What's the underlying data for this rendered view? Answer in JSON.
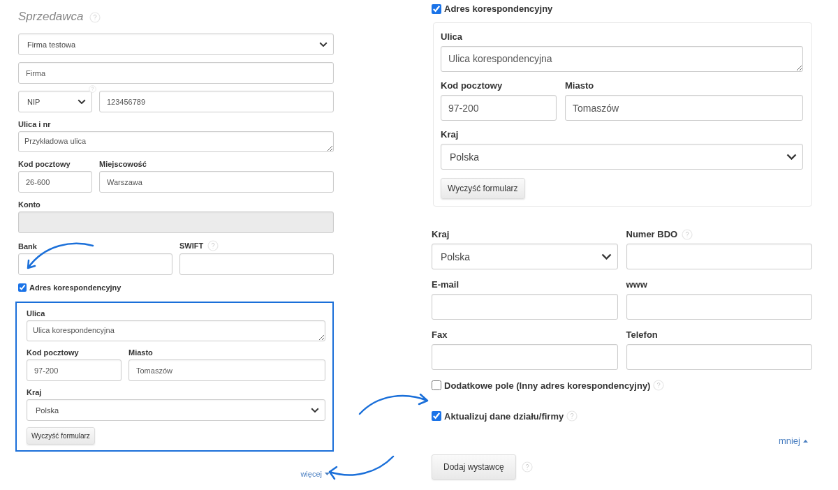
{
  "seller": {
    "title": "Sprzedawca",
    "title_help": true,
    "company": {
      "value": "Firma testowa"
    },
    "name": {
      "value": "Firma"
    },
    "tax_id": {
      "type": "NIP",
      "value": "123456789",
      "help": true
    },
    "street": {
      "label": "Ulica i nr",
      "value": "Przykładowa ulica"
    },
    "postal_code": {
      "label": "Kod pocztowy",
      "value": "26-600"
    },
    "city": {
      "label": "Miejscowość",
      "value": "Warszawa"
    },
    "account": {
      "label": "Konto",
      "disabled": true
    },
    "bank": {
      "label": "Bank"
    },
    "swift": {
      "label": "SWIFT",
      "help": true
    },
    "correspondence": {
      "label": "Adres korespondencyjny",
      "checked": true,
      "highlighted": true,
      "street": {
        "label": "Ulica",
        "value": "Ulica korespondencyjna"
      },
      "postal_code": {
        "label": "Kod pocztowy",
        "value": "97-200"
      },
      "city": {
        "label": "Miasto",
        "value": "Tomaszów"
      },
      "country": {
        "label": "Kraj",
        "value": "Polska"
      },
      "clear_button": "Wyczyść formularz"
    },
    "more_link": "więcej"
  },
  "expanded": {
    "correspondence": {
      "label": "Adres korespondencyjny",
      "checked": true,
      "highlighted": false,
      "street": {
        "label": "Ulica",
        "value": "Ulica korespondencyjna"
      },
      "postal_code": {
        "label": "Kod pocztowy",
        "value": "97-200"
      },
      "city": {
        "label": "Miasto",
        "value": "Tomaszów"
      },
      "country": {
        "label": "Kraj",
        "value": "Polska"
      },
      "clear_button": "Wyczyść formularz"
    },
    "country": {
      "label": "Kraj",
      "value": "Polska"
    },
    "bdo": {
      "label": "Numer BDO",
      "help": true
    },
    "email": {
      "label": "E-mail"
    },
    "www": {
      "label": "www"
    },
    "fax": {
      "label": "Fax"
    },
    "phone": {
      "label": "Telefon"
    },
    "extra_field": {
      "label": "Dodatkowe pole (Inny adres korespondencyjny)",
      "checked": false,
      "help": true
    },
    "update_company": {
      "label": "Aktualizuj dane działu/firmy",
      "checked": true,
      "help": true
    },
    "less_link": "mniej",
    "add_button": "Dodaj wystawcę",
    "add_help": true
  }
}
